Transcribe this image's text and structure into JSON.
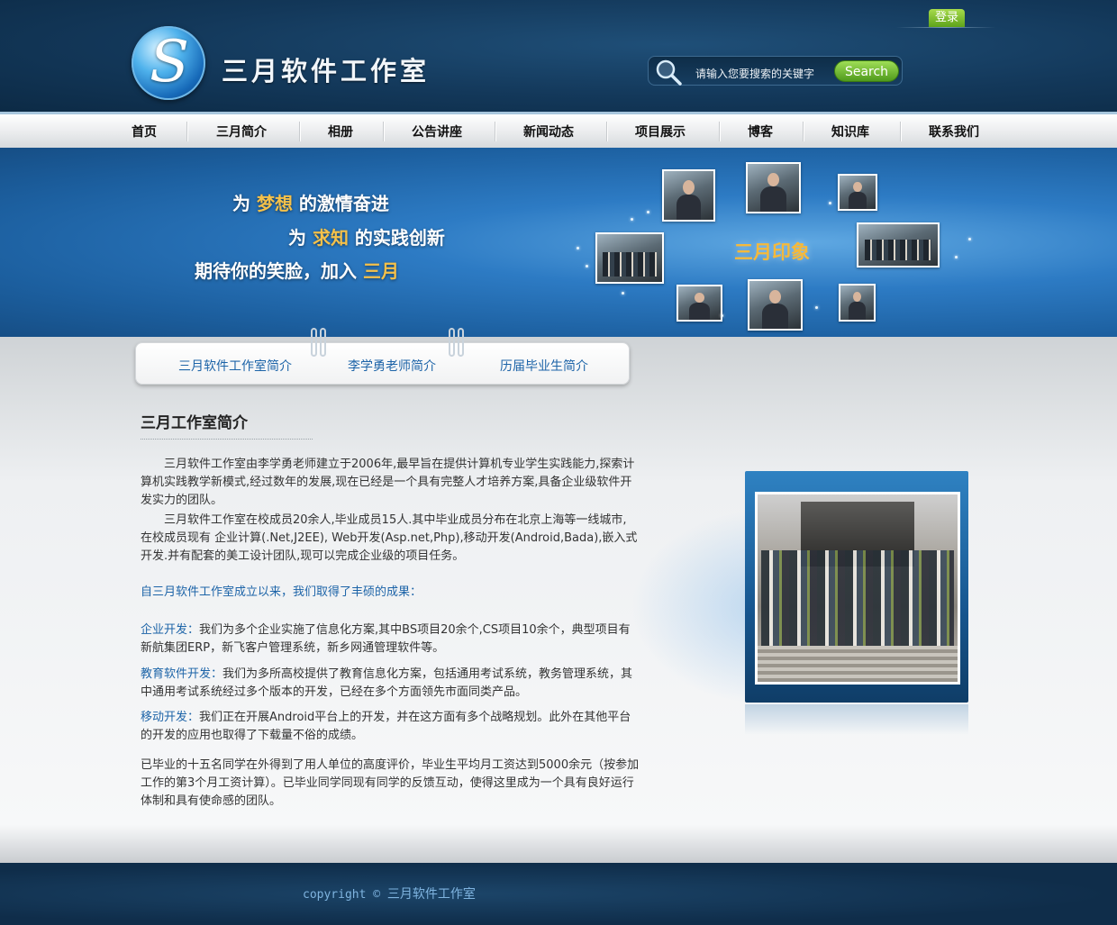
{
  "header": {
    "logo_letter": "S",
    "site_name": "三月软件工作室",
    "login": "登录",
    "search_placeholder": "请输入您要搜索的关键字",
    "search_button": "Search"
  },
  "nav": {
    "items": [
      "首页",
      "三月简介",
      "相册",
      "公告讲座",
      "新闻动态",
      "项目展示",
      "博客",
      "知识库",
      "联系我们"
    ]
  },
  "banner": {
    "line1": {
      "pre": "为 ",
      "hl": "梦想",
      "post": " 的激情奋进"
    },
    "line2": {
      "pre": "为 ",
      "hl": "求知",
      "post": " 的实践创新"
    },
    "line3": {
      "pre": "期待你的笑脸，加入 ",
      "hl": "三月",
      "post": ""
    },
    "impression": "三月印象"
  },
  "tabs": [
    "三月软件工作室简介",
    "李学勇老师简介",
    "历届毕业生简介"
  ],
  "main": {
    "title": "三月工作室简介",
    "p1": "　　三月软件工作室由李学勇老师建立于2006年,最早旨在提供计算机专业学生实践能力,探索计算机实践教学新模式,经过数年的发展,现在已经是一个具有完整人才培养方案,具备企业级软件开发实力的团队。",
    "p2": "　　三月软件工作室在校成员20余人,毕业成员15人.其中毕业成员分布在北京上海等一线城市, 在校成员现有 企业计算(.Net,J2EE), Web开发(Asp.net,Php),移动开发(Android,Bada),嵌入式开发.并有配套的美工设计团队,现可以完成企业级的项目任务。",
    "intro": "自三月软件工作室成立以来，我们取得了丰硕的成果：",
    "items": [
      {
        "lead": "企业开发：",
        "text": "我们为多个企业实施了信息化方案,其中BS项目20余个,CS项目10余个，典型项目有新航集团ERP，新飞客户管理系统，新乡网通管理软件等。"
      },
      {
        "lead": "教育软件开发：",
        "text": "我们为多所高校提供了教育信息化方案，包括通用考试系统，教务管理系统，其中通用考试系统经过多个版本的开发，已经在多个方面领先市面同类产品。"
      },
      {
        "lead": "移动开发：",
        "text": "我们正在开展Android平台上的开发，并在这方面有多个战略规划。此外在其他平台的开发的应用也取得了下载量不俗的成绩。"
      }
    ],
    "closing": "已毕业的十五名同学在外得到了用人单位的高度评价，毕业生平均月工资达到5000余元（按参加工作的第3个月工资计算）。已毕业同学同现有同学的反馈互动，使得这里成为一个具有良好运行体制和具有使命感的团队。"
  },
  "footer": {
    "copyright_en": "copyright © ",
    "copyright_cn": "三月软件工作室"
  }
}
